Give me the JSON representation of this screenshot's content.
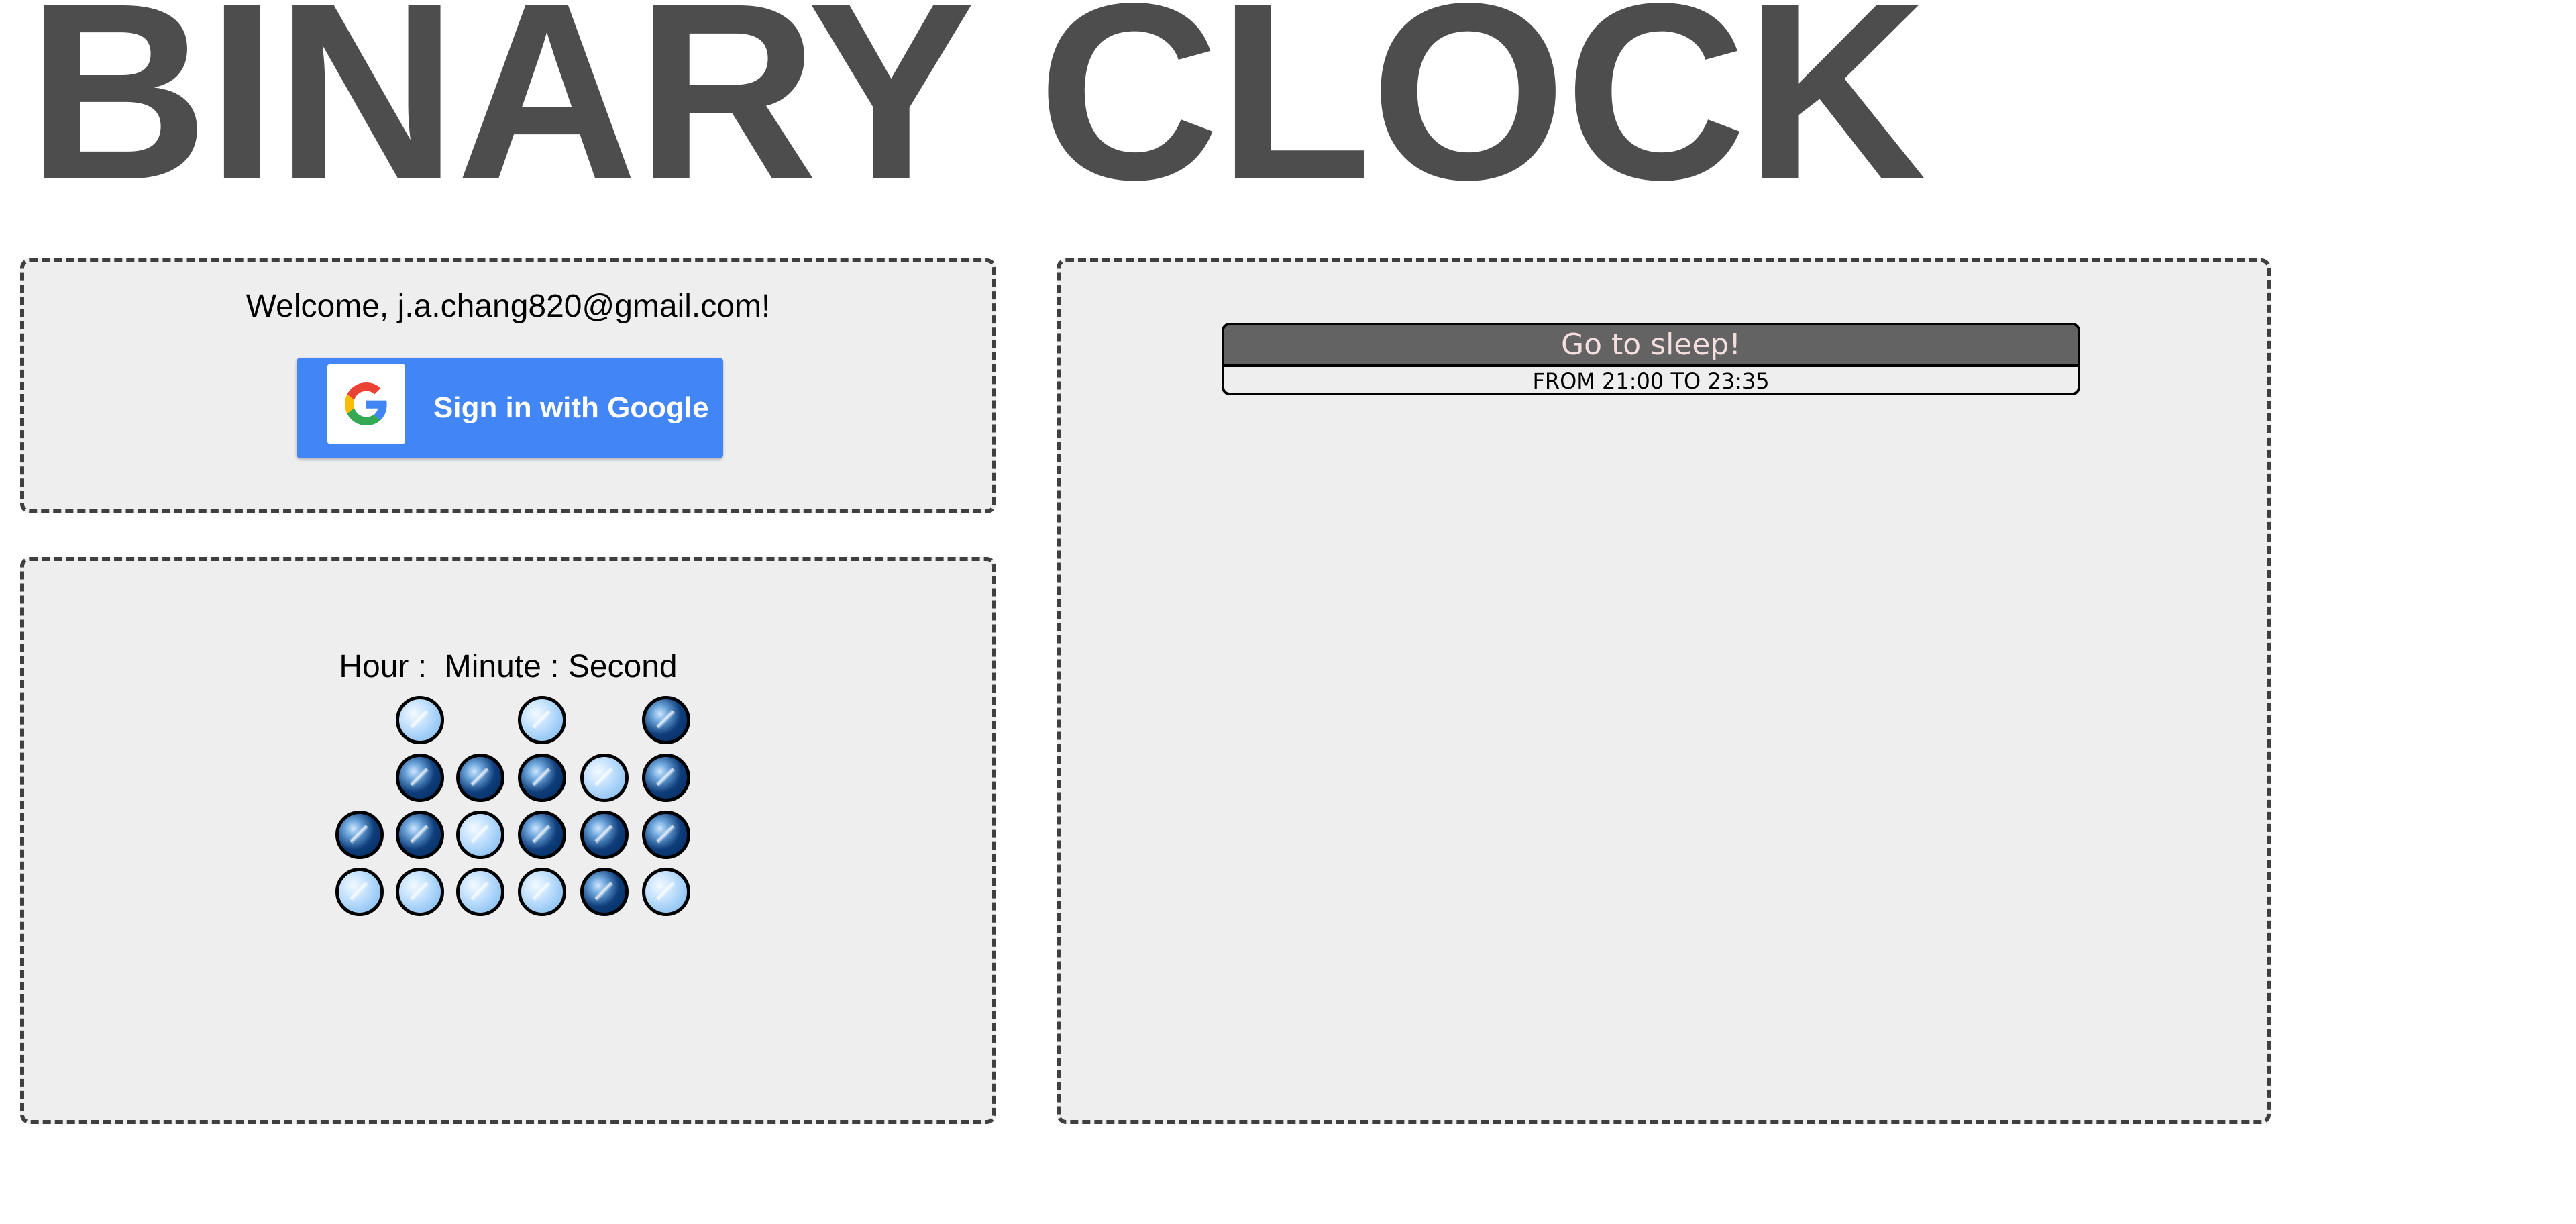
{
  "app": {
    "title": "BINARY CLOCK"
  },
  "auth": {
    "welcome_text": "Welcome, j.a.chang820@gmail.com!",
    "google_button_label": "Sign in with Google",
    "google_icon": "google-g-logo-icon"
  },
  "clock": {
    "header": "Hour :  Minute : Second",
    "columns": [
      {
        "unit": "hour-tens",
        "bits_top_to_bottom": [
          null,
          null,
          1,
          0
        ]
      },
      {
        "unit": "hour-ones",
        "bits_top_to_bottom": [
          0,
          1,
          1,
          0
        ]
      },
      {
        "unit": "minute-tens",
        "bits_top_to_bottom": [
          null,
          1,
          0,
          0
        ]
      },
      {
        "unit": "minute-ones",
        "bits_top_to_bottom": [
          0,
          1,
          1,
          0
        ]
      },
      {
        "unit": "second-tens",
        "bits_top_to_bottom": [
          null,
          0,
          1,
          1
        ]
      },
      {
        "unit": "second-ones",
        "bits_top_to_bottom": [
          1,
          1,
          1,
          0
        ]
      }
    ],
    "colors": {
      "on": "#0e3d7a",
      "off": "#a9d3f8"
    }
  },
  "schedule": {
    "events": [
      {
        "title": "Go to sleep!",
        "time": "FROM 21:00 TO 23:35"
      }
    ]
  }
}
